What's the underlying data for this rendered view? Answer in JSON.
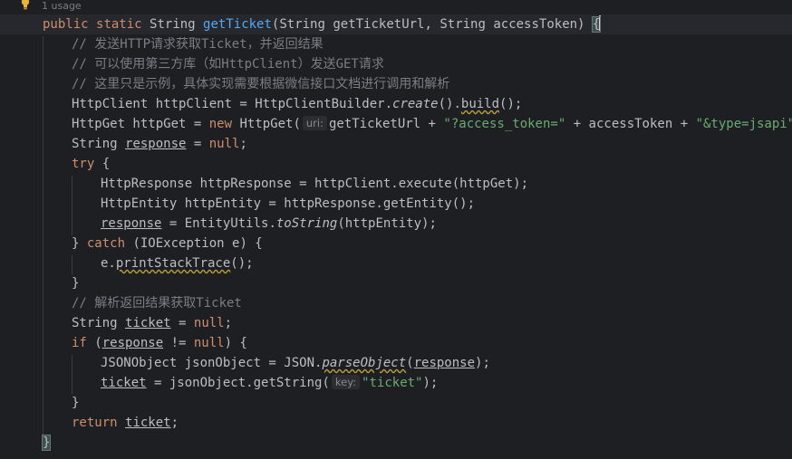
{
  "usage": {
    "text": "1 usage",
    "icon": "lightbulb-icon"
  },
  "code": {
    "l1": {
      "kw1": "public",
      "kw2": "static",
      "type": "String",
      "name": "getTicket",
      "p1": "(String getTicketUrl, String accessToken) ",
      "brace": "{"
    },
    "l2": "// 发送HTTP请求获取Ticket，并返回结果",
    "l3": "// 可以使用第三方库（如HttpClient）发送GET请求",
    "l4": "// 这里只是示例，具体实现需要根据微信接口文档进行调用和解析",
    "l5": {
      "a": "HttpClient httpClient = HttpClientBuilder.",
      "create": "create",
      "b": "().",
      "build": "build",
      "c": "();"
    },
    "l6": {
      "a": "HttpGet httpGet = ",
      "new": "new",
      "b": " HttpGet(",
      "hint": "uri:",
      "c": "getTicketUrl + ",
      "s1": "\"?access_token=\"",
      "d": " + accessToken + ",
      "s2": "\"&type=jsapi\"",
      "e": ");"
    },
    "l7": {
      "a": "String ",
      "var": "response",
      "b": " = ",
      "null": "null",
      "c": ";"
    },
    "l8": {
      "try": "try",
      "b": " {"
    },
    "l9": "HttpResponse httpResponse = httpClient.execute(httpGet);",
    "l10": "HttpEntity httpEntity = httpResponse.getEntity();",
    "l11": {
      "var": "response",
      "a": " = EntityUtils.",
      "toString": "toString",
      "b": "(httpEntity);"
    },
    "l12": {
      "a": "} ",
      "catch": "catch",
      "b": " (IOException e) {"
    },
    "l13": {
      "a": "e.",
      "m": "printStackTrace",
      "b": "();"
    },
    "l14": "}",
    "l15": "// 解析返回结果获取Ticket",
    "l16": {
      "a": "String ",
      "var": "ticket",
      "b": " = ",
      "null": "null",
      "c": ";"
    },
    "l17": {
      "if": "if",
      "a": " (",
      "var": "response",
      "b": " != ",
      "null": "null",
      "c": ") {"
    },
    "l18": {
      "a": "JSONObject jsonObject = JSON.",
      "m": "parseObject",
      "b": "(",
      "var": "response",
      "c": ");"
    },
    "l19": {
      "var": "ticket",
      "a": " = jsonObject.getString(",
      "hint": "key:",
      "s": "\"ticket\"",
      "b": ");"
    },
    "l20": "}",
    "l21": {
      "ret": "return",
      "sp": " ",
      "var": "ticket",
      "c": ";"
    },
    "l22": "}"
  }
}
